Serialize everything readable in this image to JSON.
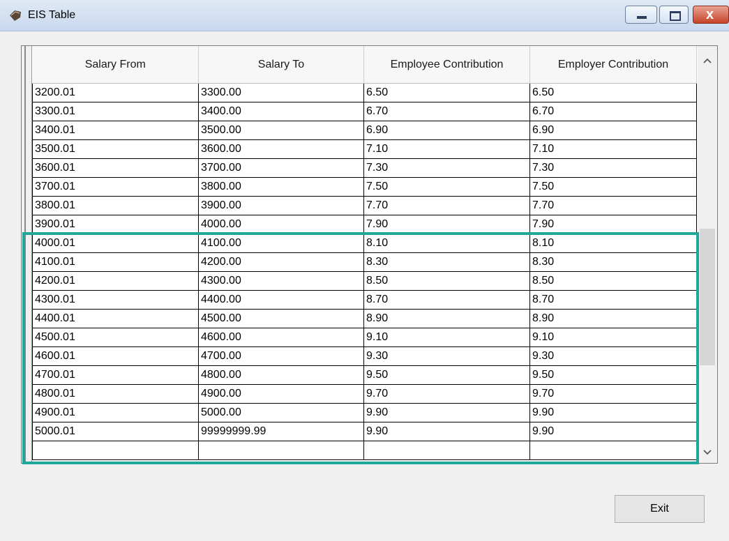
{
  "window": {
    "title": "EIS Table",
    "app_icon": "leaf-app-icon"
  },
  "titlebar_buttons": {
    "minimize": "minimize-icon",
    "maximize": "maximize-icon",
    "close": "close-icon",
    "close_glyph": "x"
  },
  "table": {
    "columns": [
      "Salary From",
      "Salary To",
      "Employee Contribution",
      "Employer Contribution"
    ],
    "rows": [
      [
        "3200.01",
        "3300.00",
        "6.50",
        "6.50"
      ],
      [
        "3300.01",
        "3400.00",
        "6.70",
        "6.70"
      ],
      [
        "3400.01",
        "3500.00",
        "6.90",
        "6.90"
      ],
      [
        "3500.01",
        "3600.00",
        "7.10",
        "7.10"
      ],
      [
        "3600.01",
        "3700.00",
        "7.30",
        "7.30"
      ],
      [
        "3700.01",
        "3800.00",
        "7.50",
        "7.50"
      ],
      [
        "3800.01",
        "3900.00",
        "7.70",
        "7.70"
      ],
      [
        "3900.01",
        "4000.00",
        "7.90",
        "7.90"
      ],
      [
        "4000.01",
        "4100.00",
        "8.10",
        "8.10"
      ],
      [
        "4100.01",
        "4200.00",
        "8.30",
        "8.30"
      ],
      [
        "4200.01",
        "4300.00",
        "8.50",
        "8.50"
      ],
      [
        "4300.01",
        "4400.00",
        "8.70",
        "8.70"
      ],
      [
        "4400.01",
        "4500.00",
        "8.90",
        "8.90"
      ],
      [
        "4500.01",
        "4600.00",
        "9.10",
        "9.10"
      ],
      [
        "4600.01",
        "4700.00",
        "9.30",
        "9.30"
      ],
      [
        "4700.01",
        "4800.00",
        "9.50",
        "9.50"
      ],
      [
        "4800.01",
        "4900.00",
        "9.70",
        "9.70"
      ],
      [
        "4900.01",
        "5000.00",
        "9.90",
        "9.90"
      ],
      [
        "5000.01",
        "99999999.99",
        "9.90",
        "9.90"
      ],
      [
        "",
        "",
        "",
        ""
      ]
    ]
  },
  "highlight_color": "#1fa79a",
  "exit_button": {
    "label": "Exit"
  }
}
